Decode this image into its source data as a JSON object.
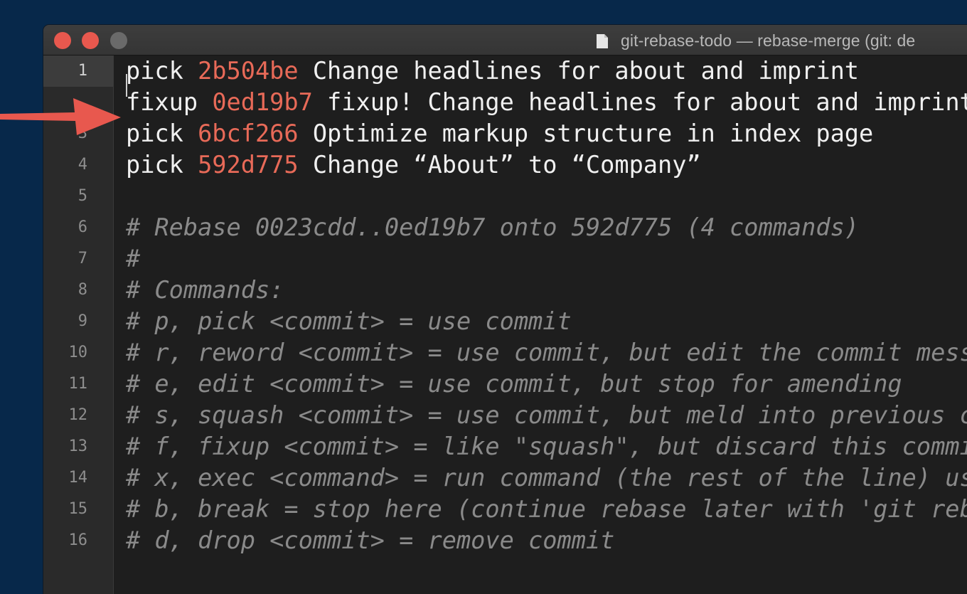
{
  "window": {
    "title": "git-rebase-todo — rebase-merge (git: de",
    "title_icon": "document-icon",
    "traffic_lights": [
      "close",
      "minimize",
      "zoom"
    ]
  },
  "colors": {
    "background": "#07284a",
    "editor_bg": "#1e1e1e",
    "hash": "#e86a58",
    "comment": "#8a8a8a",
    "arrow": "#e8584e"
  },
  "gutter": {
    "line_numbers": [
      "1",
      "",
      "3",
      "4",
      "5",
      "6",
      "7",
      "8",
      "9",
      "10",
      "11",
      "12",
      "13",
      "14",
      "15",
      "16"
    ],
    "current_line": "1"
  },
  "editor": {
    "lines": [
      {
        "type": "cmd",
        "cmd": "pick",
        "hash": "2b504be",
        "msg": "Change headlines for about and imprint"
      },
      {
        "type": "cmd",
        "cmd": "fixup",
        "hash": "0ed19b7",
        "msg": "fixup! Change headlines for about and imprint"
      },
      {
        "type": "cmd",
        "cmd": "pick",
        "hash": "6bcf266",
        "msg": "Optimize markup structure in index page"
      },
      {
        "type": "cmd",
        "cmd": "pick",
        "hash": "592d775",
        "msg": "Change “About” to “Company”"
      },
      {
        "type": "blank",
        "text": ""
      },
      {
        "type": "comment",
        "text": "# Rebase 0023cdd..0ed19b7 onto 592d775 (4 commands)"
      },
      {
        "type": "comment",
        "text": "#"
      },
      {
        "type": "comment",
        "text": "# Commands:"
      },
      {
        "type": "comment",
        "text": "# p, pick <commit> = use commit"
      },
      {
        "type": "comment",
        "text": "# r, reword <commit> = use commit, but edit the commit mess"
      },
      {
        "type": "comment",
        "text": "# e, edit <commit> = use commit, but stop for amending"
      },
      {
        "type": "comment",
        "text": "# s, squash <commit> = use commit, but meld into previous c"
      },
      {
        "type": "comment",
        "text": "# f, fixup <commit> = like \"squash\", but discard this commi"
      },
      {
        "type": "comment",
        "text": "# x, exec <command> = run command (the rest of the line) us"
      },
      {
        "type": "comment",
        "text": "# b, break = stop here (continue rebase later with 'git reb"
      },
      {
        "type": "comment",
        "text": "# d, drop <commit> = remove commit"
      }
    ]
  },
  "annotation": {
    "icon": "red-arrow-icon",
    "points_to_line": "2"
  }
}
